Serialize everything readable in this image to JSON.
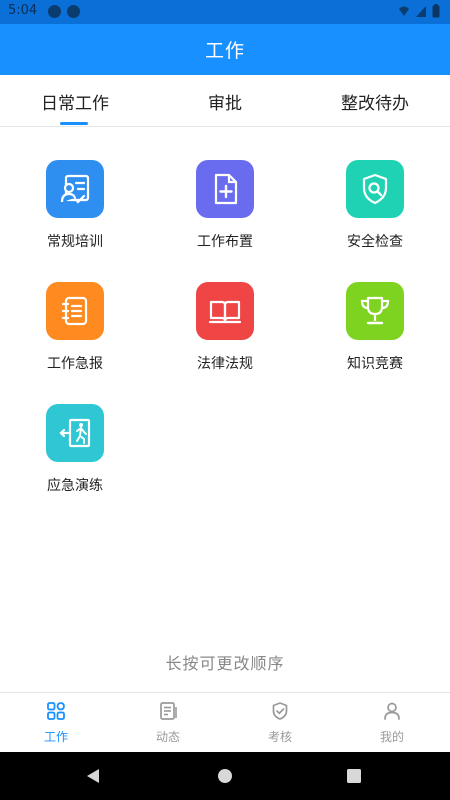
{
  "status_bar": {
    "time": "5:04"
  },
  "header": {
    "title": "工作"
  },
  "tabs": [
    {
      "label": "日常工作",
      "active": true
    },
    {
      "label": "审批",
      "active": false
    },
    {
      "label": "整改待办",
      "active": false
    }
  ],
  "grid": [
    {
      "label": "常规培训",
      "icon": "training-icon",
      "color": "#2f8ff0"
    },
    {
      "label": "工作布置",
      "icon": "document-add-icon",
      "color": "#6a6cf0"
    },
    {
      "label": "安全检查",
      "icon": "shield-search-icon",
      "color": "#1fd2b4"
    },
    {
      "label": "工作急报",
      "icon": "notebook-icon",
      "color": "#ff8a1f"
    },
    {
      "label": "法律法规",
      "icon": "book-icon",
      "color": "#ef4545"
    },
    {
      "label": "知识竞赛",
      "icon": "trophy-icon",
      "color": "#7ed321"
    },
    {
      "label": "应急演练",
      "icon": "emergency-exit-icon",
      "color": "#2ec7d3"
    }
  ],
  "hint": "长按可更改顺序",
  "bottom_nav": [
    {
      "label": "工作",
      "icon": "grid-icon",
      "active": true
    },
    {
      "label": "动态",
      "icon": "news-icon",
      "active": false
    },
    {
      "label": "考核",
      "icon": "shield-check-icon",
      "active": false
    },
    {
      "label": "我的",
      "icon": "user-icon",
      "active": false
    }
  ],
  "colors": {
    "primary": "#1890ff",
    "inactive": "#999999"
  }
}
